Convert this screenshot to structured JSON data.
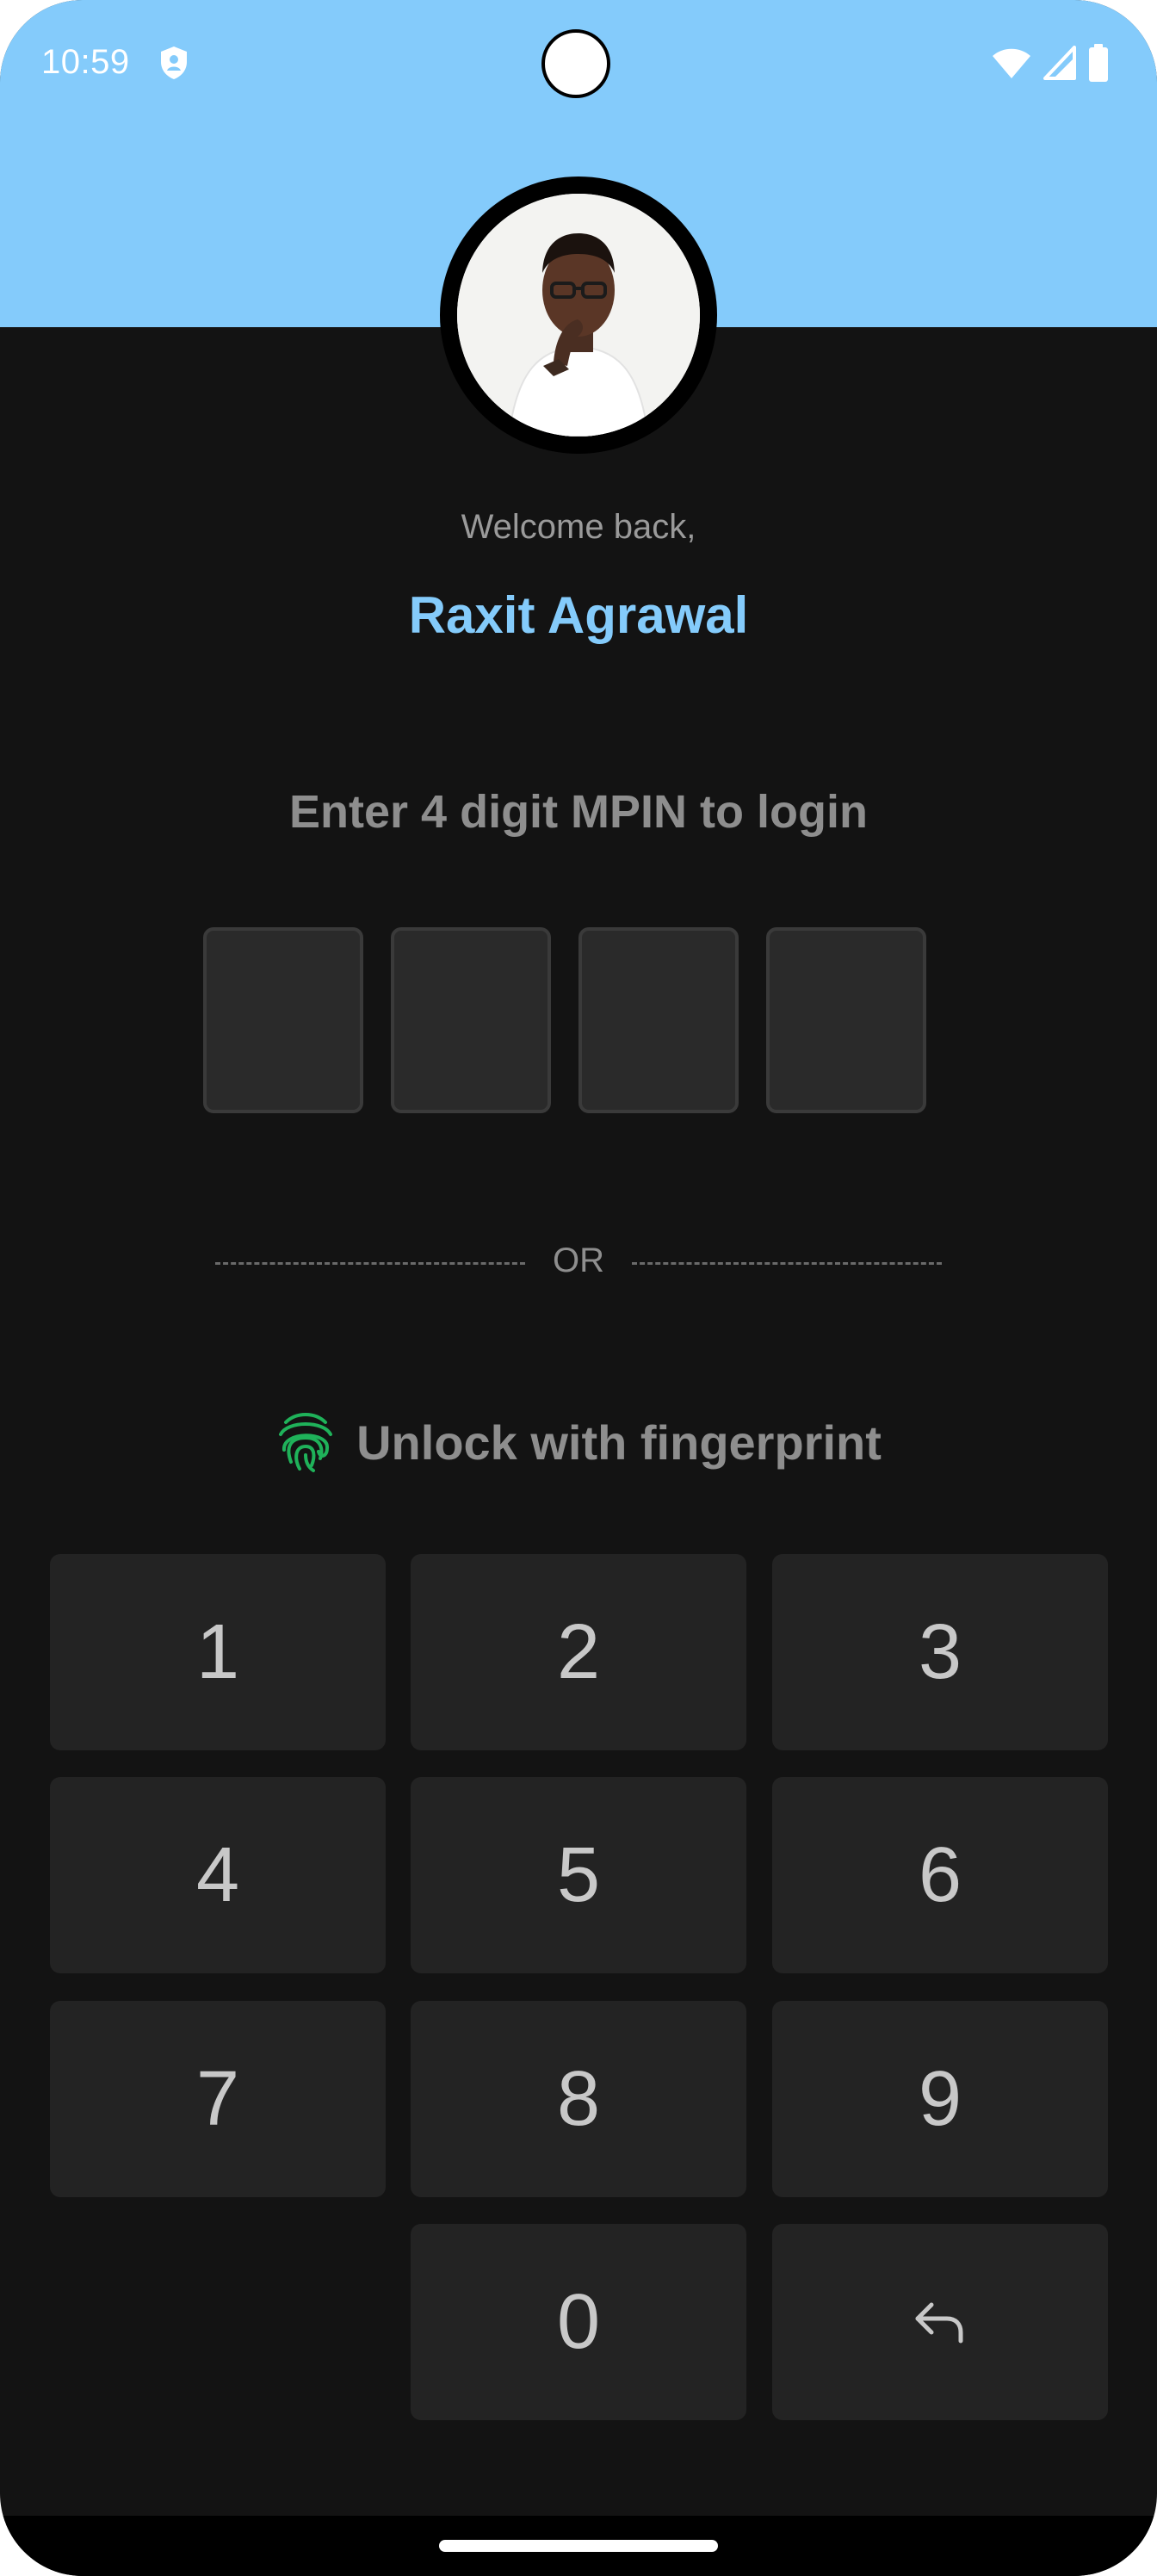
{
  "status_bar": {
    "time": "10:59",
    "icons": [
      "shield-icon",
      "wifi-icon",
      "cell-signal-icon",
      "battery-icon"
    ]
  },
  "profile": {
    "welcome_text": "Welcome back,",
    "name": "Raxit Agrawal"
  },
  "mpin": {
    "prompt": "Enter 4 digit MPIN to login",
    "digits_entered": 0,
    "digit_count": 4
  },
  "divider": {
    "label": "OR"
  },
  "fingerprint": {
    "label": "Unlock with fingerprint",
    "icon": "fingerprint-icon",
    "icon_color": "#1fb25a"
  },
  "keypad": {
    "keys": [
      "1",
      "2",
      "3",
      "4",
      "5",
      "6",
      "7",
      "8",
      "9",
      "0"
    ],
    "backspace_icon": "backspace-arrow-icon"
  },
  "colors": {
    "accent": "#84cbfb",
    "background": "#131313",
    "key_background": "#232323"
  }
}
